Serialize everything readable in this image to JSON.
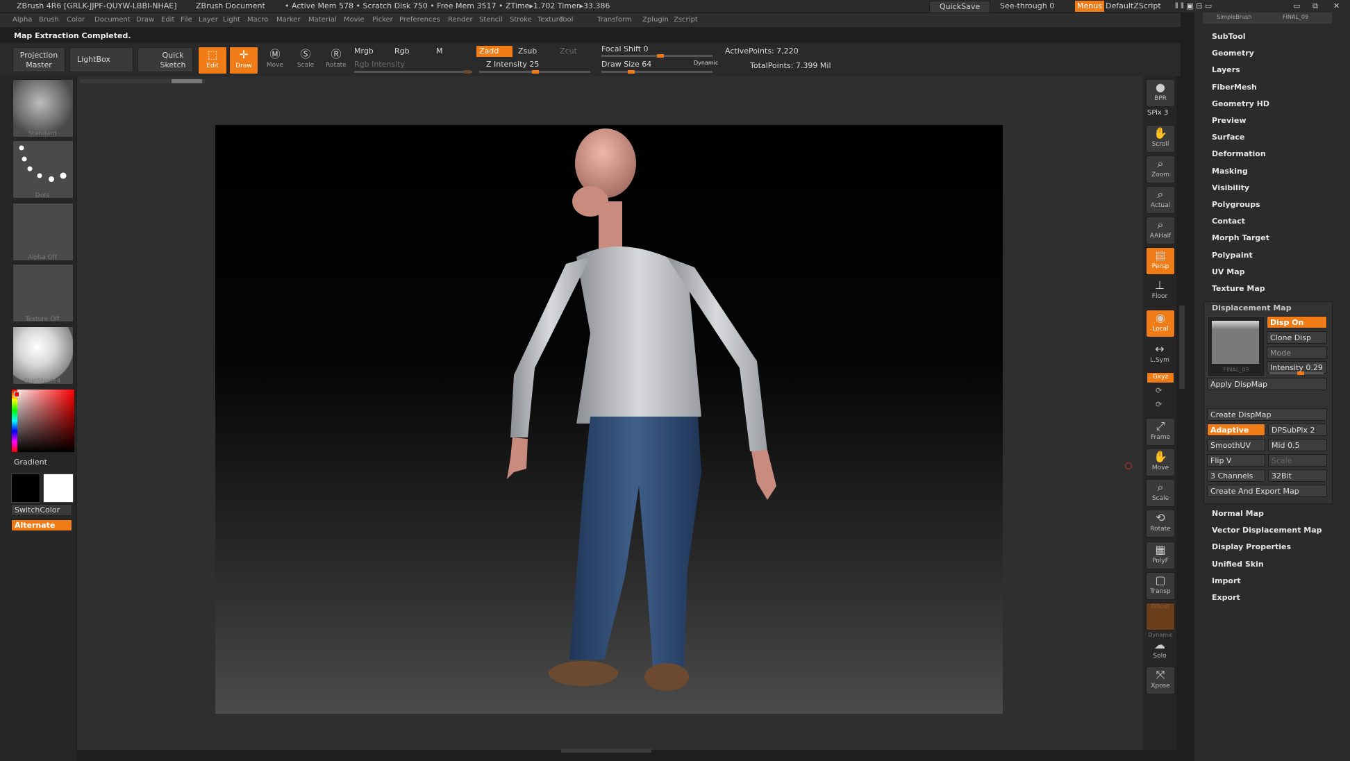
{
  "titlebar": {
    "app": "ZBrush 4R6 [GRLK-JJPF-QUYW-LBBI-NHAE]",
    "document": "ZBrush Document",
    "stats": "• Active Mem 578  • Scratch Disk 750  • Free Mem 3517  • ZTime▸1.702  Timer▸33.386",
    "quicksave": "QuickSave",
    "see_through": "See-through  0",
    "menus": "Menus",
    "script": "DefaultZScript"
  },
  "menubar": [
    "Alpha",
    "Brush",
    "Color",
    "Document",
    "Draw",
    "Edit",
    "File",
    "Layer",
    "Light",
    "Macro",
    "Marker",
    "Material",
    "Movie",
    "Picker",
    "Preferences",
    "Render",
    "Stencil",
    "Stroke",
    "Texture",
    "Tool",
    "Transform",
    "Zplugin",
    "Zscript"
  ],
  "status_message": "Map Extraction Completed.",
  "toolbar": {
    "projection_master": "Projection Master",
    "lightbox": "LightBox",
    "quick_sketch": "Quick Sketch",
    "edit": "Edit",
    "draw": "Draw",
    "move": "Move",
    "scale": "Scale",
    "rotate": "Rotate",
    "mrgb": "Mrgb",
    "rgb": "Rgb",
    "m": "M",
    "rgb_intensity": "Rgb Intensity",
    "zadd": "Zadd",
    "zsub": "Zsub",
    "zcut": "Zcut",
    "z_intensity": "Z Intensity 25",
    "focal_shift": "Focal Shift 0",
    "draw_size": "Draw Size 64",
    "dynamic": "Dynamic",
    "active_points": "ActivePoints: 7,220",
    "total_points": "TotalPoints: 7.399 Mil"
  },
  "left_shelf": {
    "brush": "Standard",
    "stroke": "Dots",
    "alpha": "Alpha Off",
    "texture": "Texture Off",
    "material": "SkinShade4",
    "gradient": "Gradient",
    "switch_color": "SwitchColor",
    "alternate": "Alternate"
  },
  "right_shelf": {
    "bpr": "BPR",
    "spix": "SPix 3",
    "scroll": "Scroll",
    "zoom": "Zoom",
    "actual": "Actual",
    "aahalf": "AAHalf",
    "persp": "Persp",
    "floor": "Floor",
    "local": "Local",
    "lsym": "L.Sym",
    "xyz": "Gxyz",
    "frame": "Frame",
    "move": "Move",
    "scale": "Scale",
    "rotate": "Rotate",
    "polyf": "PolyF",
    "transp": "Transp",
    "ghost": "Ghost",
    "dynamic": "Dynamic",
    "solo": "Solo",
    "xpose": "Xpose"
  },
  "right_panel": {
    "tool_thumbs": [
      "SimpleBrush",
      "FINAL_09"
    ],
    "items_top": [
      "SubTool",
      "Geometry",
      "Layers",
      "FiberMesh",
      "Geometry HD",
      "Preview",
      "Surface",
      "Deformation",
      "Masking",
      "Visibility",
      "Polygroups",
      "Contact",
      "Morph Target",
      "Polypaint",
      "UV Map",
      "Texture Map"
    ],
    "displacement": {
      "title": "Displacement Map",
      "thumb_label": "FINAL_09",
      "disp_on": "Disp On",
      "clone_disp": "Clone Disp",
      "mode": "Mode",
      "intensity": "Intensity 0.29",
      "apply": "Apply DispMap",
      "create": "Create DispMap",
      "adaptive": "Adaptive",
      "dpsubpix": "DPSubPix 2",
      "smoothuv": "SmoothUV",
      "mid": "Mid 0.5",
      "flipv": "Flip V",
      "scale": "Scale",
      "channels": "3 Channels",
      "bit": "32Bit",
      "create_export": "Create And Export Map"
    },
    "items_bottom": [
      "Normal Map",
      "Vector Displacement Map",
      "Display Properties",
      "Unified Skin",
      "Import",
      "Export"
    ]
  },
  "colors": {
    "accent": "#f07c17",
    "canvas": "#2f2f2f",
    "panel": "#2b2b2b"
  }
}
